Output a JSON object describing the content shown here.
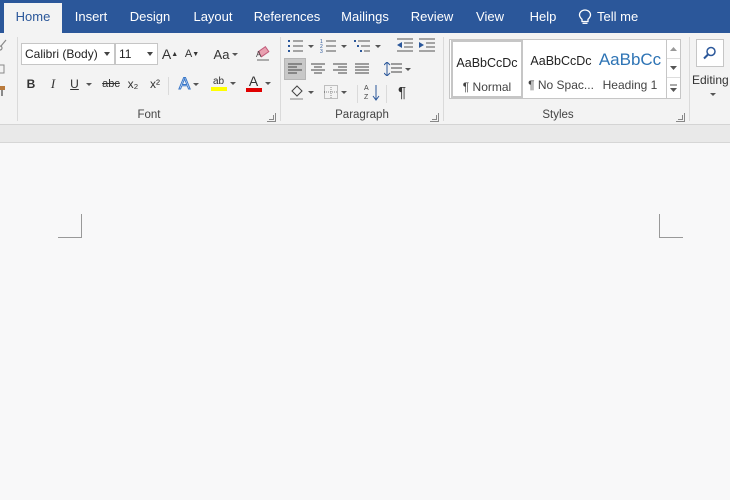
{
  "tabs": [
    {
      "label": "Home",
      "active": true
    },
    {
      "label": "Insert"
    },
    {
      "label": "Design"
    },
    {
      "label": "Layout"
    },
    {
      "label": "References"
    },
    {
      "label": "Mailings"
    },
    {
      "label": "Review"
    },
    {
      "label": "View"
    },
    {
      "label": "Help"
    }
  ],
  "tell_me": {
    "label": "Tell me",
    "icon": "lightbulb-icon"
  },
  "font": {
    "family": "Calibri (Body)",
    "size": "11",
    "change_case_label": "Aa",
    "strikethrough_label": "abc",
    "subscript_label": "x₂",
    "superscript_label": "x²",
    "bold_label": "B",
    "italic_label": "I",
    "underline_label": "U",
    "text_effects_label": "A",
    "highlight_label": "ab",
    "font_color_label": "A",
    "grow_label": "A",
    "shrink_label": "A",
    "highlight_color": "#ffff00",
    "font_color": "#e00000",
    "group_label": "Font"
  },
  "paragraph": {
    "group_label": "Paragraph",
    "show_marks_label": "¶"
  },
  "styles": {
    "group_label": "Styles",
    "items": [
      {
        "preview": "AaBbCcDc",
        "name": "¶ Normal",
        "selected": true
      },
      {
        "preview": "AaBbCcDc",
        "name": "¶ No Spac..."
      },
      {
        "preview": "AaBbCc",
        "name": "Heading 1"
      }
    ]
  },
  "editing": {
    "label": "Editing"
  },
  "colors": {
    "tabbar": "#2b579a",
    "ribbon": "#f3f3f3",
    "heading_blue": "#2e74b5"
  }
}
